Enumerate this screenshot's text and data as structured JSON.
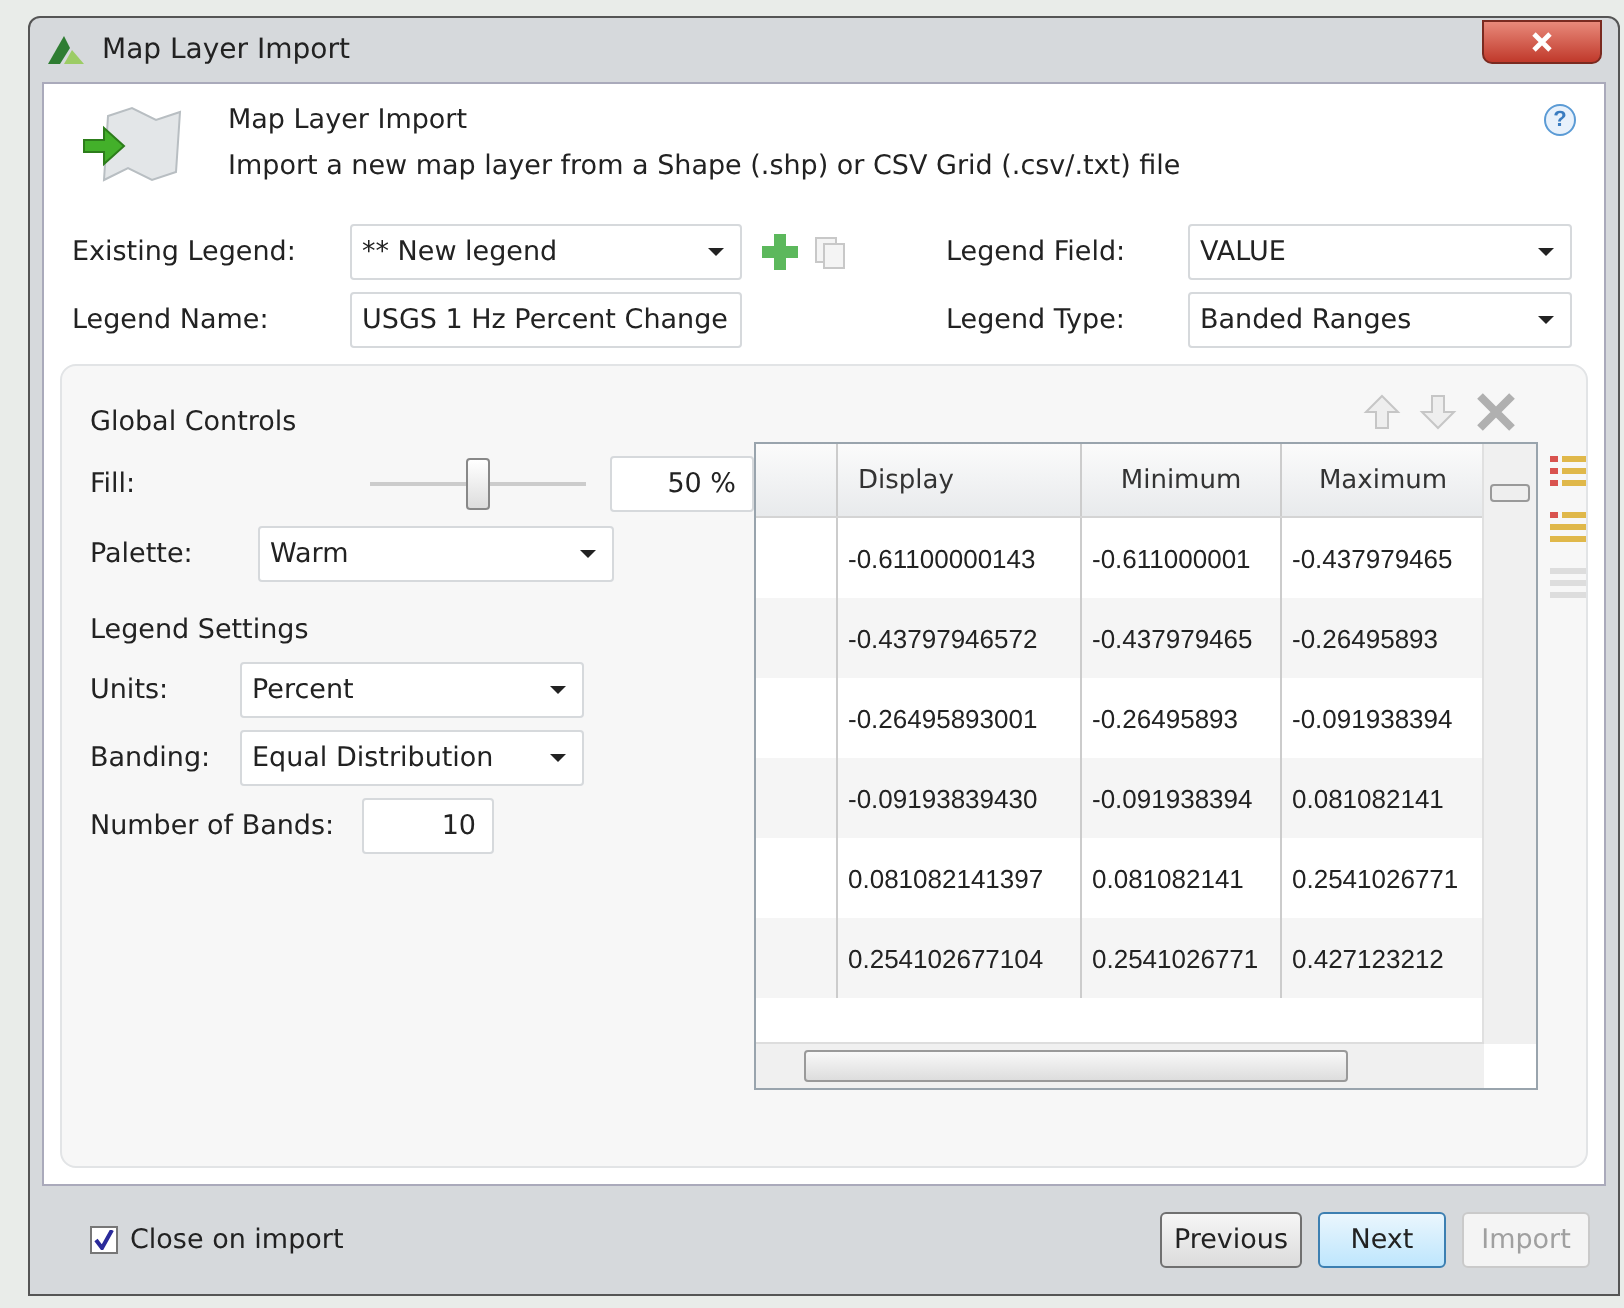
{
  "window": {
    "title": "Map Layer Import"
  },
  "header": {
    "title": "Map Layer Import",
    "description": "Import a new map layer from a Shape (.shp) or CSV Grid (.csv/.txt) file",
    "help": "?"
  },
  "legend": {
    "existing": {
      "label": "Existing Legend:",
      "value": "** New legend"
    },
    "name": {
      "label": "Legend Name:",
      "value": "USGS 1 Hz Percent Change"
    },
    "field": {
      "label": "Legend Field:",
      "value": "VALUE"
    },
    "type": {
      "label": "Legend Type:",
      "value": "Banded Ranges"
    }
  },
  "global_controls": {
    "title": "Global Controls",
    "fill": {
      "label": "Fill:",
      "level": 0.5,
      "value": "50 %"
    },
    "palette": {
      "label": "Palette:",
      "value": "Warm"
    }
  },
  "legend_settings": {
    "title": "Legend Settings",
    "units": {
      "label": "Units:",
      "value": "Percent"
    },
    "banding": {
      "label": "Banding:",
      "value": "Equal Distribution"
    },
    "bands": {
      "label": "Number of Bands:",
      "value": "10"
    }
  },
  "table": {
    "columns": [
      "Display",
      "Minimum",
      "Maximum"
    ],
    "rows": [
      [
        "-0.61100000143",
        "-0.611000001",
        "-0.437979465"
      ],
      [
        "-0.43797946572",
        "-0.437979465",
        "-0.26495893"
      ],
      [
        "-0.26495893001",
        "-0.26495893",
        "-0.091938394"
      ],
      [
        "-0.09193839430",
        "-0.091938394",
        "0.081082141"
      ],
      [
        "0.081082141397",
        "0.081082141",
        "0.2541026771"
      ],
      [
        "0.254102677104",
        "0.2541026771",
        "0.427123212"
      ]
    ]
  },
  "footer": {
    "close_on_import": {
      "label": "Close on import",
      "checked": true
    },
    "buttons": [
      {
        "label": "Previous",
        "kind": "default",
        "disabled": false
      },
      {
        "label": "Next",
        "kind": "primary",
        "disabled": false
      },
      {
        "label": "Import",
        "kind": "default",
        "disabled": true
      }
    ]
  }
}
